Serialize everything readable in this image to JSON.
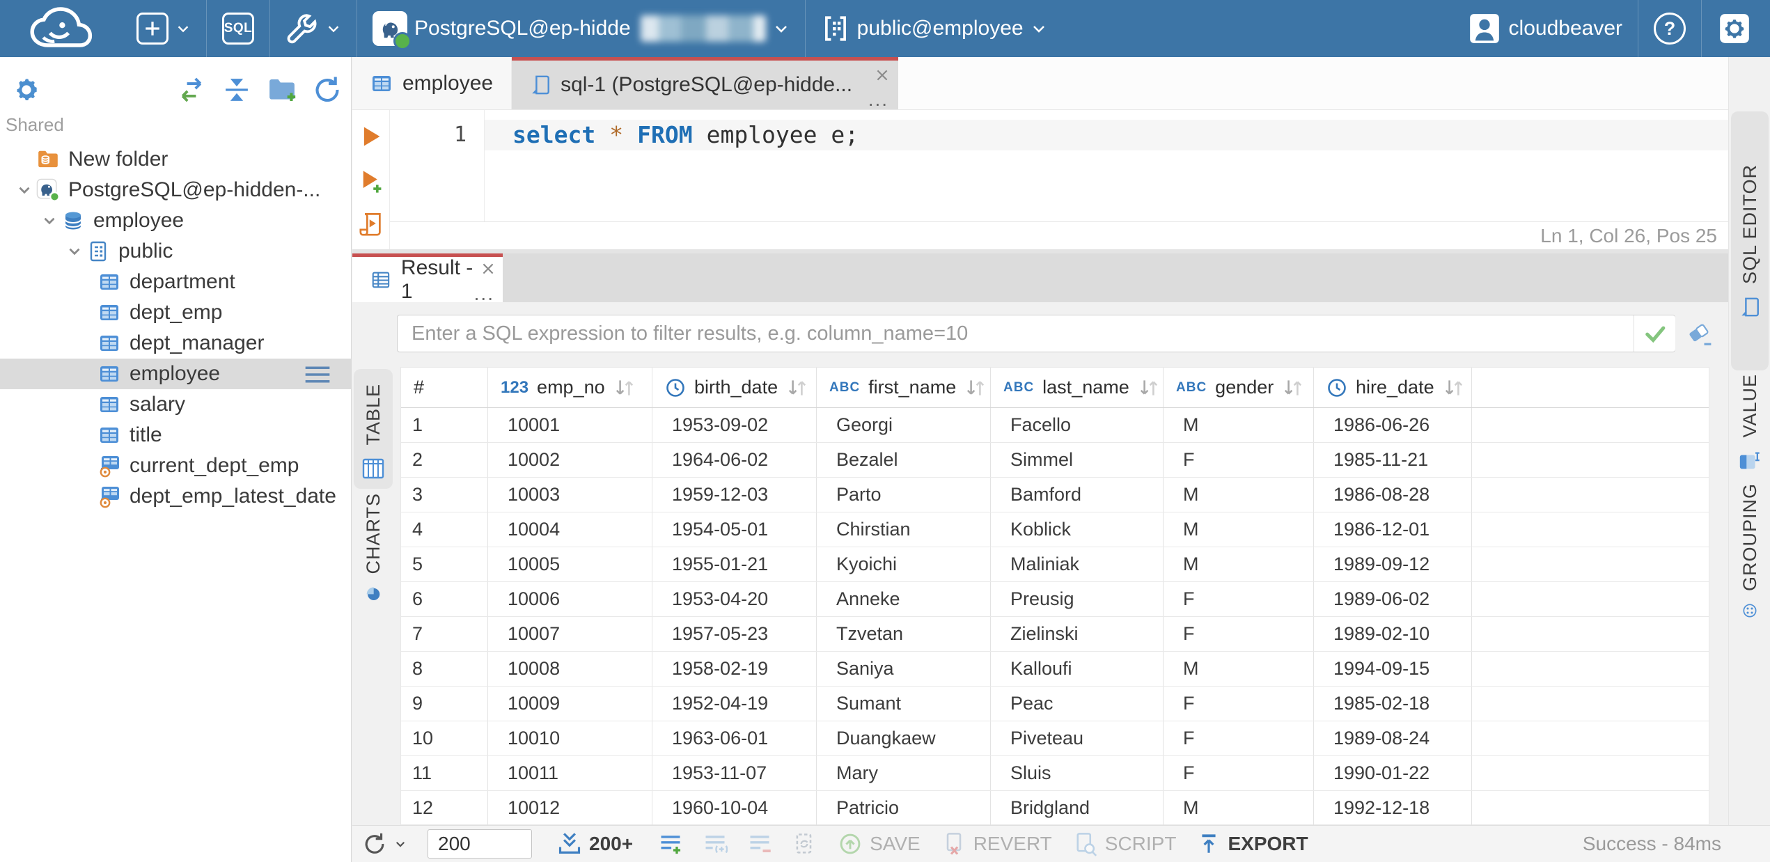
{
  "topbar": {
    "sql_button_label": "SQL",
    "connection_name": "PostgreSQL@ep-hidde",
    "schema_selector": "public@employee",
    "user_name": "cloudbeaver",
    "help_label": "?"
  },
  "sidebar": {
    "section_label": "Shared",
    "tree": [
      {
        "label": "New folder",
        "type": "folder",
        "depth": 0
      },
      {
        "label": "PostgreSQL@ep-hidden-...",
        "type": "connection",
        "depth": 0,
        "expanded": true
      },
      {
        "label": "employee",
        "type": "database",
        "depth": 1,
        "expanded": true
      },
      {
        "label": "public",
        "type": "schema",
        "depth": 2,
        "expanded": true
      },
      {
        "label": "department",
        "type": "table",
        "depth": 3
      },
      {
        "label": "dept_emp",
        "type": "table",
        "depth": 3
      },
      {
        "label": "dept_manager",
        "type": "table",
        "depth": 3
      },
      {
        "label": "employee",
        "type": "table",
        "depth": 3,
        "selected": true
      },
      {
        "label": "salary",
        "type": "table",
        "depth": 3
      },
      {
        "label": "title",
        "type": "table",
        "depth": 3
      },
      {
        "label": "current_dept_emp",
        "type": "view",
        "depth": 3
      },
      {
        "label": "dept_emp_latest_date",
        "type": "view",
        "depth": 3
      }
    ]
  },
  "editor": {
    "tabs": [
      {
        "label": "employee",
        "icon": "table",
        "active": false
      },
      {
        "label": "sql-1 (PostgreSQL@ep-hidde...",
        "icon": "sqlfile",
        "active": true
      }
    ],
    "tab_more": "...",
    "line_number": "1",
    "code": {
      "kw1": "select",
      "star": "*",
      "kw2": "FROM",
      "rest": "employee e;"
    },
    "caret_status": "Ln 1, Col 26, Pos 25"
  },
  "right_rail": {
    "tabs": [
      {
        "label": "SQL EDITOR"
      },
      {
        "label": "VALUE"
      },
      {
        "label": "GROUPING"
      }
    ]
  },
  "result": {
    "tab_label": "Result - 1",
    "tab_more": "...",
    "filter_placeholder": "Enter a SQL expression to filter results, e.g. column_name=10",
    "presentations": [
      {
        "label": "TABLE",
        "active": true
      },
      {
        "label": "CHARTS",
        "active": false
      }
    ],
    "grid": {
      "columns": [
        {
          "label": "#",
          "type": "rownum"
        },
        {
          "label": "emp_no",
          "type": "number"
        },
        {
          "label": "birth_date",
          "type": "date"
        },
        {
          "label": "first_name",
          "type": "text"
        },
        {
          "label": "last_name",
          "type": "text"
        },
        {
          "label": "gender",
          "type": "text"
        },
        {
          "label": "hire_date",
          "type": "date"
        }
      ],
      "rows": [
        [
          "1",
          "10001",
          "1953-09-02",
          "Georgi",
          "Facello",
          "M",
          "1986-06-26"
        ],
        [
          "2",
          "10002",
          "1964-06-02",
          "Bezalel",
          "Simmel",
          "F",
          "1985-11-21"
        ],
        [
          "3",
          "10003",
          "1959-12-03",
          "Parto",
          "Bamford",
          "M",
          "1986-08-28"
        ],
        [
          "4",
          "10004",
          "1954-05-01",
          "Chirstian",
          "Koblick",
          "M",
          "1986-12-01"
        ],
        [
          "5",
          "10005",
          "1955-01-21",
          "Kyoichi",
          "Maliniak",
          "M",
          "1989-09-12"
        ],
        [
          "6",
          "10006",
          "1953-04-20",
          "Anneke",
          "Preusig",
          "F",
          "1989-06-02"
        ],
        [
          "7",
          "10007",
          "1957-05-23",
          "Tzvetan",
          "Zielinski",
          "F",
          "1989-02-10"
        ],
        [
          "8",
          "10008",
          "1958-02-19",
          "Saniya",
          "Kalloufi",
          "M",
          "1994-09-15"
        ],
        [
          "9",
          "10009",
          "1952-04-19",
          "Sumant",
          "Peac",
          "F",
          "1985-02-18"
        ],
        [
          "10",
          "10010",
          "1963-06-01",
          "Duangkaew",
          "Piveteau",
          "F",
          "1989-08-24"
        ],
        [
          "11",
          "10011",
          "1953-11-07",
          "Mary",
          "Sluis",
          "F",
          "1990-01-22"
        ],
        [
          "12",
          "10012",
          "1960-10-04",
          "Patricio",
          "Bridgland",
          "M",
          "1992-12-18"
        ]
      ]
    }
  },
  "toolbar": {
    "row_limit": "200",
    "fetch_more": "200+",
    "save": "SAVE",
    "revert": "REVERT",
    "script": "SCRIPT",
    "export": "EXPORT",
    "status": "Success - 84ms"
  }
}
